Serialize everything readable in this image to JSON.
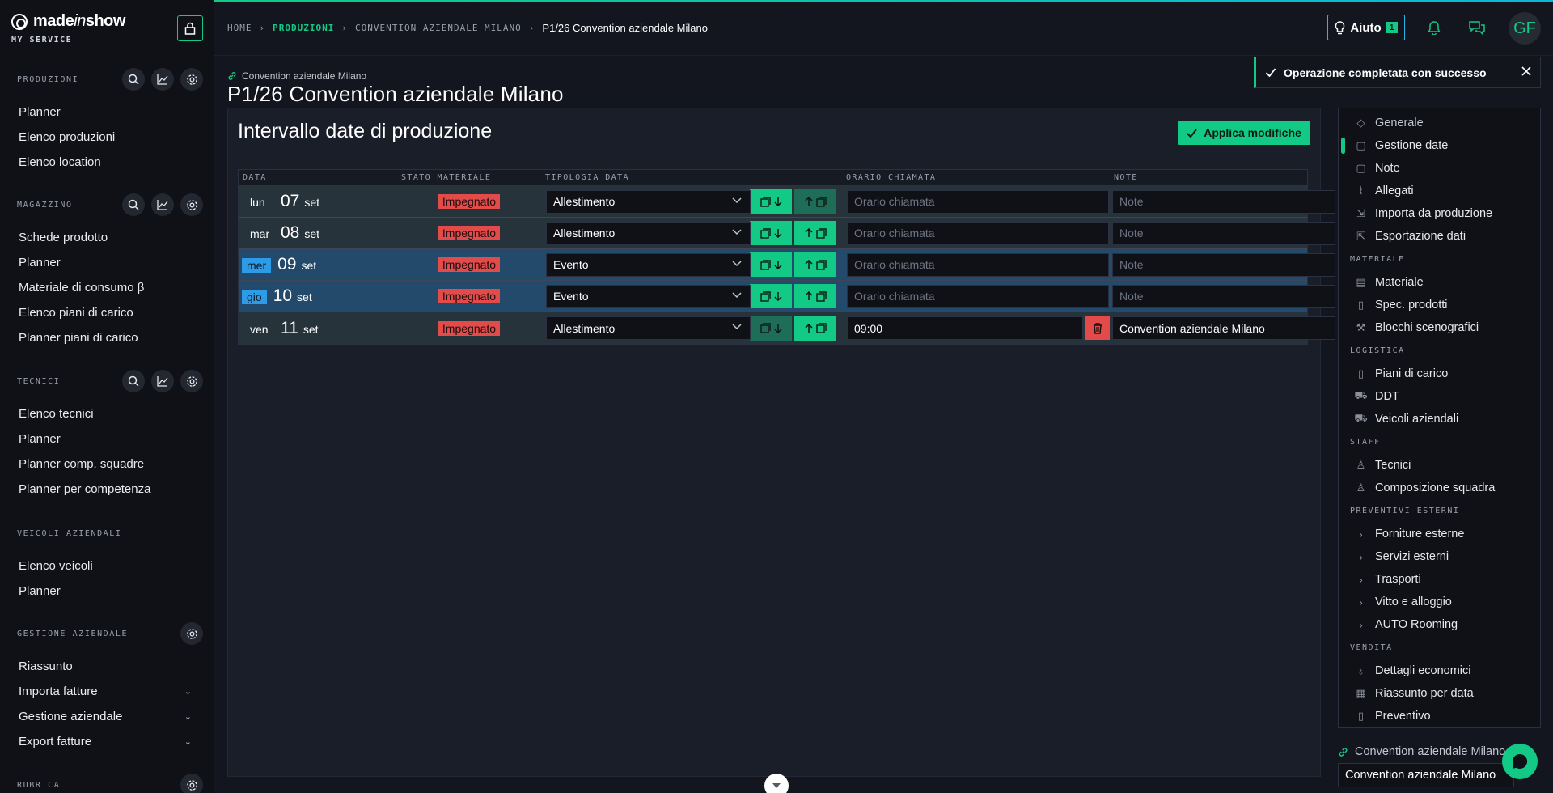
{
  "brand": {
    "logo_text_a": "made",
    "logo_text_b": "in",
    "logo_text_c": "show",
    "subtitle": "MY SERVICE"
  },
  "colors": {
    "accent": "#12c985",
    "danger": "#e34b4b",
    "info": "#2e9be6"
  },
  "sidebar": {
    "produzioni": {
      "title": "PRODUZIONI",
      "items": [
        "Planner",
        "Elenco produzioni",
        "Elenco location"
      ]
    },
    "magazzino": {
      "title": "MAGAZZINO",
      "items": [
        "Schede prodotto",
        "Planner",
        "Materiale di consumo β",
        "Elenco piani di carico",
        "Planner piani di carico"
      ]
    },
    "tecnici": {
      "title": "TECNICI",
      "items": [
        "Elenco tecnici",
        "Planner",
        "Planner comp. squadre",
        "Planner per competenza"
      ]
    },
    "veicoli": {
      "title": "VEICOLI AZIENDALI",
      "items": [
        "Elenco veicoli",
        "Planner"
      ]
    },
    "gestione": {
      "title": "GESTIONE AZIENDALE",
      "items": [
        "Riassunto",
        "Importa fatture",
        "Gestione aziendale",
        "Export fatture"
      ]
    },
    "rubrica": {
      "title": "RUBRICA"
    }
  },
  "header": {
    "breadcrumb": [
      "HOME",
      "PRODUZIONI",
      "CONVENTION AZIENDALE MILANO",
      "P1/26 Convention aziendale Milano"
    ],
    "help_label": "Aiuto",
    "help_badge": "1",
    "avatar": "GF"
  },
  "page": {
    "link": "Convention aziendale Milano",
    "title": "P1/26 Convention aziendale Milano"
  },
  "toast": {
    "message": "Operazione completata con successo"
  },
  "panel": {
    "title": "Intervallo date di produzione",
    "apply_label": "Applica modifiche",
    "columns": [
      "DATA",
      "STATO MATERIALE",
      "TIPOLOGIA DATA",
      "ORARIO CHIAMATA",
      "NOTE"
    ],
    "rows": [
      {
        "day": "lun",
        "num": "07",
        "month": "set",
        "stato": "Impegnato",
        "tipo": "Allestimento",
        "orario": "",
        "orario_placeholder": "Orario chiamata",
        "note": "",
        "note_placeholder": "Note"
      },
      {
        "day": "mar",
        "num": "08",
        "month": "set",
        "stato": "Impegnato",
        "tipo": "Allestimento",
        "orario": "",
        "orario_placeholder": "Orario chiamata",
        "note": "",
        "note_placeholder": "Note"
      },
      {
        "day": "mer",
        "num": "09",
        "month": "set",
        "stato": "Impegnato",
        "tipo": "Evento",
        "orario": "",
        "orario_placeholder": "Orario chiamata",
        "note": "",
        "note_placeholder": "Note"
      },
      {
        "day": "gio",
        "num": "10",
        "month": "set",
        "stato": "Impegnato",
        "tipo": "Evento",
        "orario": "",
        "orario_placeholder": "Orario chiamata",
        "note": "",
        "note_placeholder": "Note"
      },
      {
        "day": "ven",
        "num": "11",
        "month": "set",
        "stato": "Impegnato",
        "tipo": "Allestimento",
        "orario": "09:00",
        "orario_placeholder": "Orario chiamata",
        "note": "Convention aziendale Milano",
        "note_placeholder": "Note"
      }
    ]
  },
  "rnav": {
    "top": [
      "Generale",
      "Gestione date",
      "Note",
      "Allegati",
      "Importa da produzione",
      "Esportazione dati"
    ],
    "materiale": {
      "title": "MATERIALE",
      "items": [
        "Materiale",
        "Spec. prodotti",
        "Blocchi scenografici"
      ]
    },
    "logistica": {
      "title": "LOGISTICA",
      "items": [
        "Piani di carico",
        "DDT",
        "Veicoli aziendali"
      ]
    },
    "staff": {
      "title": "STAFF",
      "items": [
        "Tecnici",
        "Composizione squadra"
      ]
    },
    "preventivi": {
      "title": "PREVENTIVI ESTERNI",
      "items": [
        "Forniture esterne",
        "Servizi esterni",
        "Trasporti",
        "Vitto e alloggio",
        "AUTO Rooming"
      ]
    },
    "vendita": {
      "title": "VENDITA",
      "items": [
        "Dettagli economici",
        "Riassunto per data",
        "Preventivo"
      ]
    },
    "foot_link": "Convention aziendale Milano",
    "foot_input": "Convention aziendale Milano"
  }
}
